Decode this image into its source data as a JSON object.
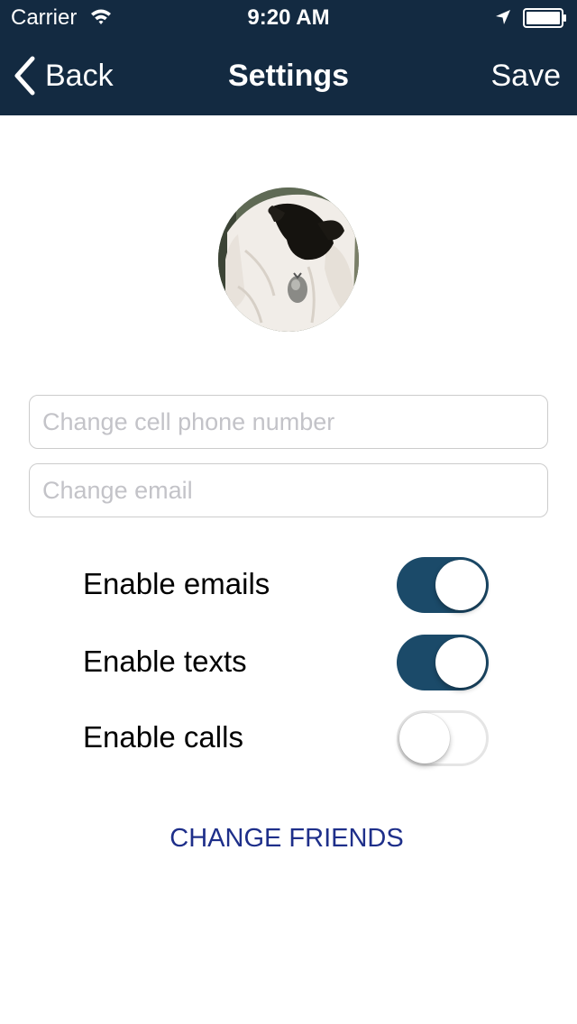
{
  "status_bar": {
    "carrier": "Carrier",
    "time": "9:20 AM",
    "icons": [
      "wifi-icon",
      "location-arrow-icon",
      "battery-icon"
    ]
  },
  "nav": {
    "back_label": "Back",
    "title": "Settings",
    "save_label": "Save",
    "background_color": "#132a41",
    "text_color": "#ffffff"
  },
  "profile": {
    "avatar": "profile photo"
  },
  "form": {
    "phone_placeholder": "Change cell phone number",
    "phone_value": "",
    "email_placeholder": "Change email",
    "email_value": ""
  },
  "toggles": [
    {
      "label": "Enable emails",
      "on": true
    },
    {
      "label": "Enable texts",
      "on": true
    },
    {
      "label": "Enable calls",
      "on": false
    }
  ],
  "toggle_on_color": "#1b4a69",
  "change_friends_label": "CHANGE FRIENDS",
  "link_color": "#1e2f8a"
}
